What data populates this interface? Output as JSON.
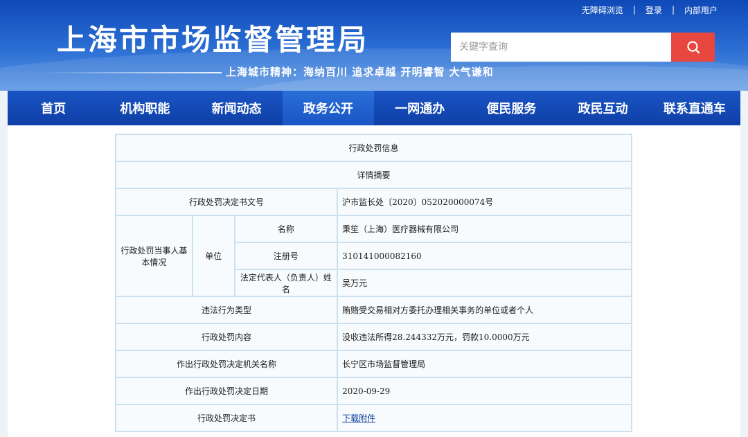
{
  "header": {
    "top_links": [
      "无障碍浏览",
      "登录",
      "内部用户"
    ],
    "title": "上海市市场监督管理局",
    "motto": "上海城市精神：海纳百川  追求卓越  开明睿智  大气谦和",
    "search_placeholder": "关键字查询",
    "search_icon": "search-icon"
  },
  "nav": {
    "items": [
      "首页",
      "机构职能",
      "新闻动态",
      "政务公开",
      "一网通办",
      "便民服务",
      "政民互动",
      "联系直通车"
    ],
    "active": "政务公开"
  },
  "table": {
    "title": "行政处罚信息",
    "subtitle": "详情摘要",
    "doc_no_label": "行政处罚决定书文号",
    "doc_no_value": "沪市监长处〔2020〕052020000074号",
    "party_label": "行政处罚当事人基本情况",
    "unit_label": "单位",
    "name_label": "名称",
    "name_value": "秉笙（上海）医疗器械有限公司",
    "reg_label": "注册号",
    "reg_value": "310141000082160",
    "rep_label": "法定代表人（负责人）姓名",
    "rep_value": "吴万元",
    "violation_label": "违法行为类型",
    "violation_value": "贿赂受交易相对方委托办理相关事务的单位或者个人",
    "content_label": "行政处罚内容",
    "content_value": "没收违法所得28.244332万元，罚款10.0000万元",
    "org_label": "作出行政处罚决定机关名称",
    "org_value": "长宁区市场监督管理局",
    "date_label": "作出行政处罚决定日期",
    "date_value": "2020-09-29",
    "decision_label": "行政处罚决定书",
    "decision_value": "下载附件"
  },
  "colors": {
    "header_blue": "#0f49b8",
    "nav_blue": "#0e3fa6",
    "search_red": "#e8473f",
    "table_border": "#cde0ee",
    "link": "#0b3f9a"
  }
}
